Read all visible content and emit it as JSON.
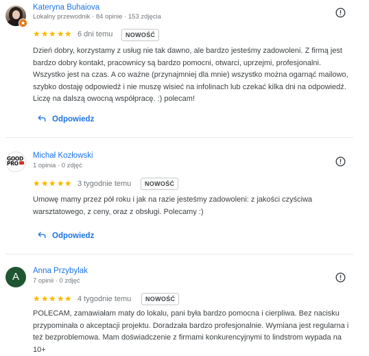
{
  "reviews": [
    {
      "author": "Kateryna Buhaiova",
      "meta": "Lokalny przewodnik · 84 opinie · 153 zdjęcia",
      "rating": 5,
      "time": "6 dni temu",
      "badge": "NOWOŚĆ",
      "text": "Dzień dobry, korzystamy z usług nie tak dawno, ale bardzo jesteśmy zadowoleni. Z firmą jest bardzo dobry kontakt, pracownicy są bardzo pomocni, otwarci, uprzejmi, profesjonalni. Wszystko jest na czas. A co ważne (przynajmniej dla mnie) wszystko można ogarnąć mailowo, szybko dostaję odpowiedź i nie muszę wisieć na infolinach lub czekać kilka dni na odpowiedź. Liczę na dalszą owocną współpracę. :) polecam!",
      "reply": "Odpowiedz",
      "avatar": "user-photo-local-guide"
    },
    {
      "author": "Michał Kozłowski",
      "meta": "1 opinia · 0 zdjęć",
      "rating": 5,
      "time": "3 tygodnie temu",
      "badge": "NOWOŚĆ",
      "text": "Umowę mamy przez pół roku i jak na razie jesteśmy zadowoleni: z jakości czyściwa warsztatowego, z ceny, oraz z obsługi. Polecamy :)",
      "reply": "Odpowiedz",
      "avatar_logo_text": "GOOD PRO"
    },
    {
      "author": "Anna Przybylak",
      "meta": "7 opinii · 0 zdjęć",
      "rating": 5,
      "time": "4 tygodnie temu",
      "badge": "NOWOŚĆ",
      "text": "POLECAM, zamawiałam maty do lokalu, pani była bardzo pomocna i cierpliwa. Bez nacisku przypominała o akceptacji projektu. Doradzała bardzo profesjonalnie. Wymiana jest regularna i też bezproblemowa. Mam doświadczenie z firmami konkurencyjnymi to lindstrom wypada na 10+",
      "avatar_letter": "A"
    }
  ],
  "colors": {
    "link": "#1a73e8",
    "star": "#fbbc04",
    "avatar_letter_bg": "#1e5631",
    "local_guide_badge": "#e8710a"
  },
  "icons": {
    "flag": "report-icon",
    "reply": "reply-arrow-icon",
    "star": "star-icon"
  }
}
